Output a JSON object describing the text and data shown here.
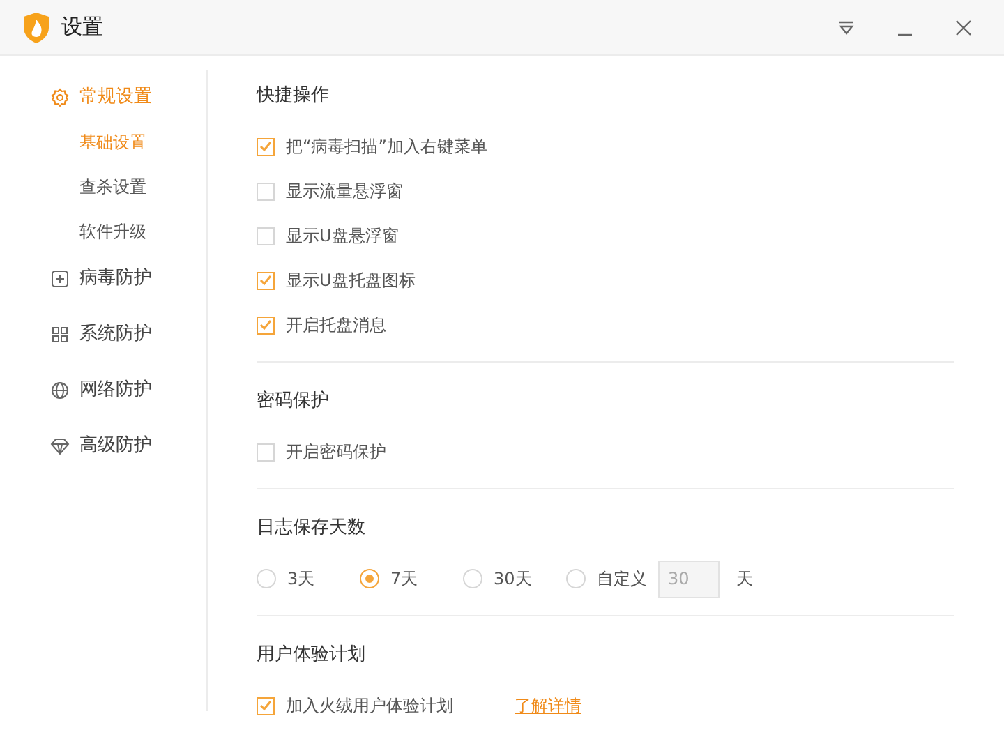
{
  "window": {
    "title": "设置"
  },
  "sidebar": {
    "items": [
      {
        "label": "常规设置",
        "selected": true,
        "children": [
          {
            "label": "基础设置",
            "selected": true
          },
          {
            "label": "查杀设置",
            "selected": false
          },
          {
            "label": "软件升级",
            "selected": false
          }
        ]
      },
      {
        "label": "病毒防护",
        "selected": false
      },
      {
        "label": "系统防护",
        "selected": false
      },
      {
        "label": "网络防护",
        "selected": false
      },
      {
        "label": "高级防护",
        "selected": false
      }
    ]
  },
  "sections": [
    {
      "title": "快捷操作",
      "items": [
        {
          "kind": "checkbox",
          "label": "把“病毒扫描”加入右键菜单",
          "checked": true
        },
        {
          "kind": "checkbox",
          "label": "显示流量悬浮窗",
          "checked": false
        },
        {
          "kind": "checkbox",
          "label": "显示U盘悬浮窗",
          "checked": false
        },
        {
          "kind": "checkbox",
          "label": "显示U盘托盘图标",
          "checked": true
        },
        {
          "kind": "checkbox",
          "label": "开启托盘消息",
          "checked": true
        }
      ]
    },
    {
      "title": "密码保护",
      "items": [
        {
          "kind": "checkbox",
          "label": "开启密码保护",
          "checked": false
        }
      ]
    },
    {
      "title": "日志保存天数",
      "items": [
        {
          "kind": "radios",
          "options": [
            {
              "label": "3天",
              "selected": false
            },
            {
              "label": "7天",
              "selected": true
            },
            {
              "label": "30天",
              "selected": false
            },
            {
              "label": "自定义",
              "selected": false,
              "value": "30",
              "suffix": "天"
            }
          ]
        }
      ]
    },
    {
      "title": "用户体验计划",
      "items": [
        {
          "kind": "checkbox",
          "label": "加入火绒用户体验计划",
          "checked": true,
          "link": "了解详情"
        }
      ]
    }
  ]
}
